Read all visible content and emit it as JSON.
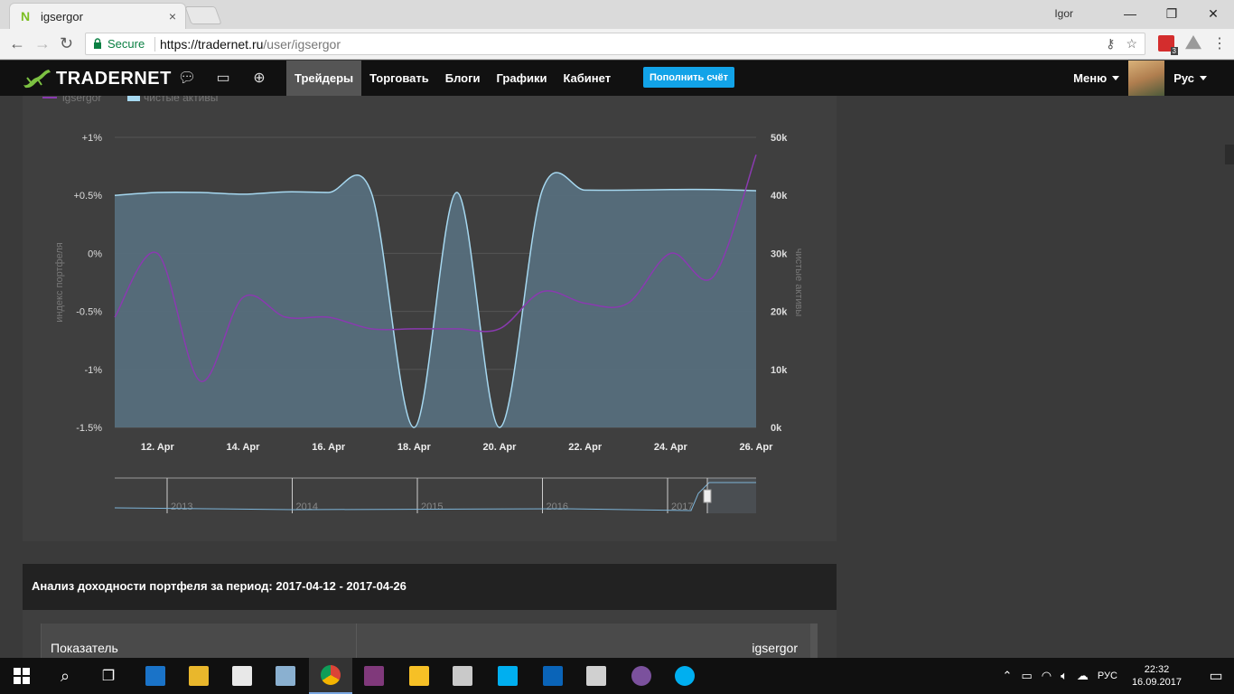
{
  "browser": {
    "tab_title": "igsergor",
    "tab_favicon": "N",
    "tab_close": "×",
    "window_user": "Igor",
    "win_min": "—",
    "win_max": "❐",
    "win_close": "✕",
    "secure_label": "Secure",
    "url_host": "https://tradernet.ru",
    "url_path": "/user/igsergor",
    "ext_badge": "3"
  },
  "site": {
    "brand": "TRADERNET",
    "menu": [
      "Трейдеры",
      "Торговать",
      "Блоги",
      "Графики",
      "Кабинет"
    ],
    "active_menu": "Трейдеры",
    "topup_label": "Пополнить счёт",
    "menu_label": "Меню",
    "lang_label": "Рус"
  },
  "chart_data": {
    "type": "area",
    "legend": [
      {
        "name": "igsergor",
        "color": "#8a3ab0"
      },
      {
        "name": "чистые активы",
        "color": "#a6d8f0"
      }
    ],
    "ylabel_left": "индекс портфеля",
    "ylabel_right": "чистые активы",
    "left_ticks": [
      "+1%",
      "+0.5%",
      "0%",
      "-0.5%",
      "-1%",
      "-1.5%"
    ],
    "left_ylim": [
      -1.5,
      1
    ],
    "right_ticks": [
      "50k",
      "40k",
      "30k",
      "20k",
      "10k",
      "0k"
    ],
    "right_ylim": [
      0,
      50000
    ],
    "x_ticks": [
      "12. Apr",
      "14. Apr",
      "16. Apr",
      "18. Apr",
      "20. Apr",
      "22. Apr",
      "24. Apr",
      "26. Apr"
    ],
    "x_range": [
      "2017-04-11",
      "2017-04-26"
    ],
    "series_assets": {
      "name": "чистые активы",
      "x": [
        "2017-04-11",
        "2017-04-12",
        "2017-04-13",
        "2017-04-14",
        "2017-04-15",
        "2017-04-16",
        "2017-04-17",
        "2017-04-18",
        "2017-04-19",
        "2017-04-20",
        "2017-04-21",
        "2017-04-22",
        "2017-04-23",
        "2017-04-24",
        "2017-04-25",
        "2017-04-26"
      ],
      "values": [
        40000,
        40500,
        40500,
        40200,
        40600,
        40500,
        40500,
        0,
        40500,
        0,
        40900,
        40900,
        40900,
        41000,
        41000,
        40800
      ]
    },
    "series_index": {
      "name": "igsergor",
      "x": [
        "2017-04-11",
        "2017-04-12",
        "2017-04-13",
        "2017-04-14",
        "2017-04-15",
        "2017-04-16",
        "2017-04-17",
        "2017-04-18",
        "2017-04-19",
        "2017-04-20",
        "2017-04-21",
        "2017-04-22",
        "2017-04-23",
        "2017-04-24",
        "2017-04-25",
        "2017-04-26"
      ],
      "values": [
        -0.55,
        0.0,
        -1.1,
        -0.38,
        -0.55,
        -0.55,
        -0.65,
        -0.65,
        -0.65,
        -0.65,
        -0.33,
        -0.43,
        -0.43,
        0.0,
        -0.2,
        0.85
      ]
    },
    "navigator_years": [
      "2013",
      "2014",
      "2015",
      "2016",
      "2017"
    ]
  },
  "analysis": {
    "title": "Анализ доходности портфеля за период: 2017-04-12 - 2017-04-26",
    "col_indicator": "Показатель",
    "col_user": "igsergor"
  },
  "taskbar": {
    "lang": "РУС",
    "time": "22:32",
    "date": "16.09.2017"
  }
}
